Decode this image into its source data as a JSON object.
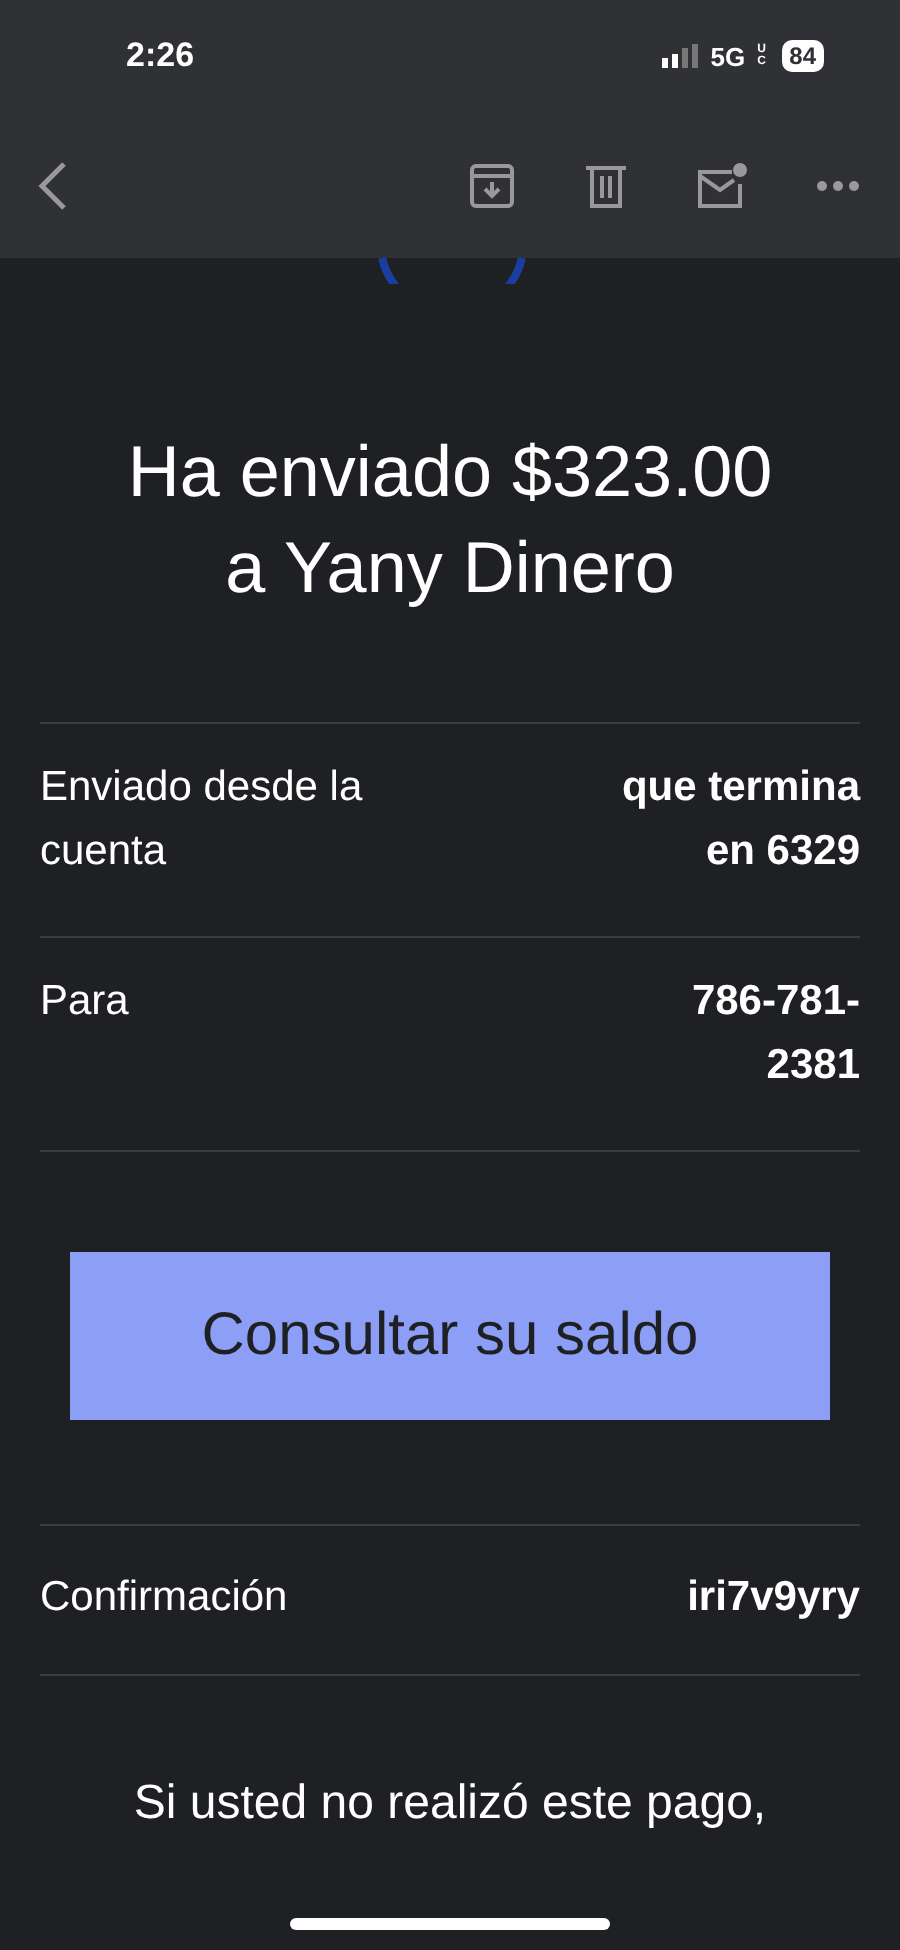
{
  "status_bar": {
    "time": "2:26",
    "network": "5G",
    "network_suffix": "UC",
    "battery": "84"
  },
  "title_lines": [
    "Ha enviado $323.00",
    "a Yany Dinero"
  ],
  "details": [
    {
      "label": "Enviado desde la cuenta",
      "value": "que termina en 6329"
    },
    {
      "label": "Para",
      "value": "786-781-2381"
    }
  ],
  "balance_button": "Consultar su saldo",
  "confirmation": {
    "label": "Confirmación",
    "value": "iri7v9yry"
  },
  "footer_text": "Si usted no realizó este pago,"
}
